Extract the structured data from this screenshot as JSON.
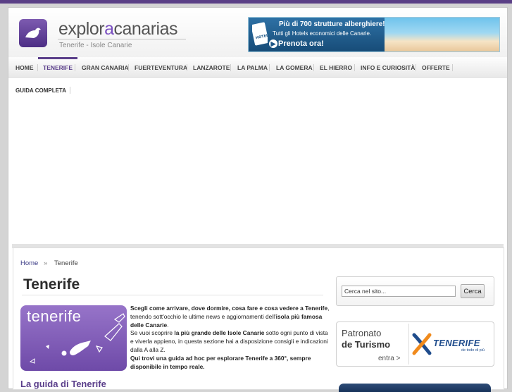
{
  "site": {
    "logo_pre": "explor",
    "logo_mid": "a",
    "logo_post": "canarias",
    "tagline": "Tenerife - Isole Canarie"
  },
  "banner": {
    "headline": "Più di 700 strutture alberghiere!",
    "subline": "Tutti gli Hotels economici delle Canarie.",
    "cta": "Prenota ora!",
    "sign_text": "HOTELS"
  },
  "nav": {
    "items": [
      "HOME",
      "TENERIFE",
      "GRAN CANARIA",
      "FUERTEVENTURA",
      "LANZAROTE",
      "LA PALMA",
      "LA GOMERA",
      "EL HIERRO",
      "INFO E CURIOSITÀ",
      "OFFERTE"
    ],
    "active": "TENERIFE",
    "sub_item": "GUIDA COMPLETA"
  },
  "breadcrumb": {
    "home": "Home",
    "sep": "»",
    "current": "Tenerife"
  },
  "page": {
    "title": "Tenerife",
    "image_label": "tenerife",
    "intro": {
      "p1a": "Scegli come arrivare, dove dormire, cosa fare e cosa vedere a",
      "p1b": "Tenerife",
      "p1c": ", tenendo sott'occhio le ultime news e aggiornamenti dell'",
      "p1d": "isola più famosa delle Canarie",
      "p1e": ".",
      "p2a": "Se vuoi scoprire ",
      "p2b": "la più grande delle Isole Canarie",
      "p2c": " sotto ogni punto di vista e viverla appieno, in questa sezione hai a disposizione consigli e indicazioni dalla A alla Z.",
      "p3": "Qui trovi una guida ad hoc per esplorare Tenerife a 360°, sempre disponibile in tempo reale."
    },
    "section_heading": "La guida di Tenerife"
  },
  "sidebar": {
    "search_value": "Cerca nel sito...",
    "search_button": "Cerca",
    "ad_line1": "Patronato",
    "ad_line2": "de Turismo",
    "ad_link": "entra >",
    "ad_logo": "TENERIFE",
    "ad_tagline": "de todo di più"
  },
  "colors": {
    "brand_purple": "#5a3e8a",
    "accent_purple": "#7a4fc0",
    "link_blue": "#3a3a85"
  }
}
